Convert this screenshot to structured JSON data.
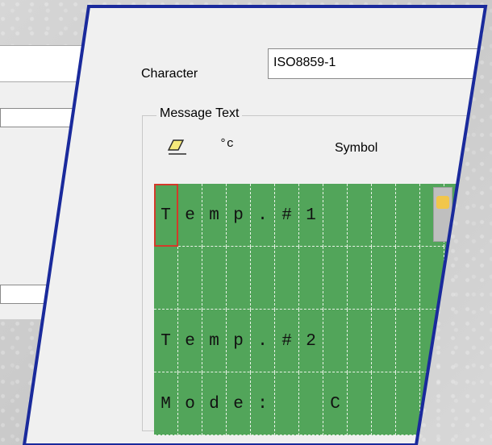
{
  "character": {
    "label": "Character",
    "value": "ISO8859-1"
  },
  "message": {
    "group_label": "Message Text",
    "tools": {
      "eraser_icon": "eraser-icon",
      "degree_label": "°c",
      "symbol_label": "Symbol"
    },
    "rows": [
      [
        "T",
        "e",
        "m",
        "p",
        ".",
        "#",
        "1",
        "",
        "",
        "",
        "",
        ""
      ],
      [
        "",
        "",
        "",
        "",
        "",
        "",
        "",
        "",
        "",
        "",
        "",
        ""
      ],
      [
        "T",
        "e",
        "m",
        "p",
        ".",
        "#",
        "2",
        "",
        "",
        "",
        "",
        ""
      ],
      [
        "M",
        "o",
        "d",
        "e",
        ":",
        "",
        "",
        "C",
        "",
        "",
        "",
        ""
      ]
    ],
    "selected_cell": {
      "row": 0,
      "col": 0
    },
    "colors": {
      "lcd_bg": "#52a55a",
      "grid_line": "#e8f2e6",
      "selection": "#d23a2a",
      "panel_border": "#1a2a9c"
    }
  }
}
